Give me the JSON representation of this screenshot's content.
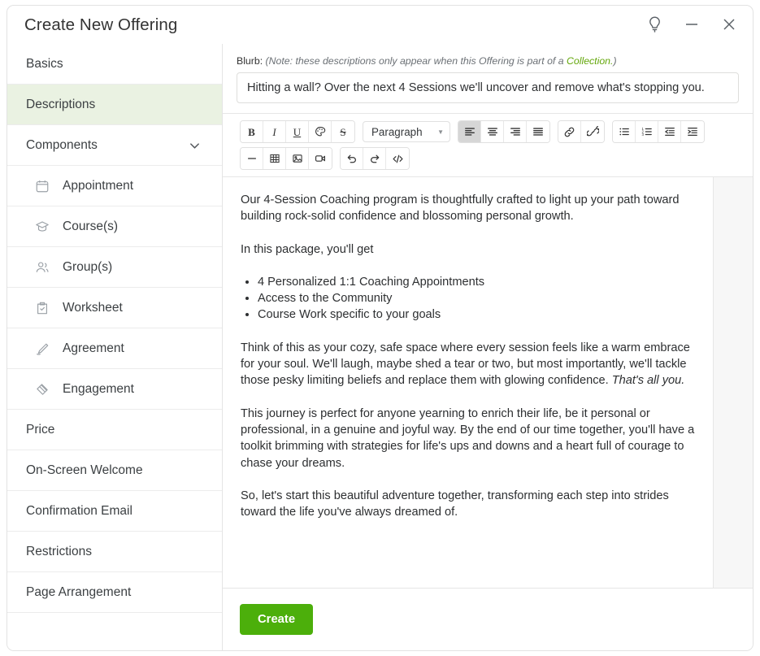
{
  "window": {
    "title": "Create New Offering",
    "controls": [
      {
        "name": "help-tips",
        "icon": "lightbulb-icon"
      },
      {
        "name": "minimize",
        "icon": "minimize-icon"
      },
      {
        "name": "close",
        "icon": "close-icon"
      }
    ]
  },
  "sidebar": {
    "items": [
      {
        "label": "Basics",
        "active": false
      },
      {
        "label": "Descriptions",
        "active": true
      },
      {
        "label": "Components",
        "active": false,
        "expandable": true,
        "expanded": true
      }
    ],
    "components": [
      {
        "label": "Appointment",
        "icon": "calendar-icon"
      },
      {
        "label": "Course(s)",
        "icon": "graduation-cap-icon"
      },
      {
        "label": "Group(s)",
        "icon": "people-icon"
      },
      {
        "label": "Worksheet",
        "icon": "clipboard-check-icon"
      },
      {
        "label": "Agreement",
        "icon": "pen-signature-icon"
      },
      {
        "label": "Engagement",
        "icon": "handshake-icon"
      }
    ],
    "items_after": [
      {
        "label": "Price"
      },
      {
        "label": "On-Screen Welcome"
      },
      {
        "label": "Confirmation Email"
      },
      {
        "label": "Restrictions"
      },
      {
        "label": "Page Arrangement"
      }
    ]
  },
  "blurb": {
    "label": "Blurb:",
    "note_prefix": "(Note: these descriptions only appear when this Offering is part of a ",
    "note_link": "Collection.",
    "note_suffix": ")",
    "value": "Hitting a wall? Over the next 4 Sessions we'll uncover and remove what's stopping you.",
    "placeholder": ""
  },
  "toolbar": {
    "row1_group1": [
      {
        "name": "bold-icon",
        "label": "B"
      },
      {
        "name": "italic-icon",
        "label": "I"
      },
      {
        "name": "underline-icon",
        "label": "U"
      },
      {
        "name": "text-color-icon",
        "label": ""
      },
      {
        "name": "strikethrough-icon",
        "label": "S"
      }
    ],
    "paragraph_select": "Paragraph",
    "row1_align": [
      {
        "name": "align-left-icon",
        "active": true
      },
      {
        "name": "align-center-icon",
        "active": false
      },
      {
        "name": "align-right-icon",
        "active": false
      },
      {
        "name": "align-justify-icon",
        "active": false
      }
    ],
    "row1_link": [
      {
        "name": "link-icon"
      },
      {
        "name": "unlink-icon"
      }
    ],
    "row1_list": [
      {
        "name": "bullet-list-icon"
      },
      {
        "name": "numbered-list-icon"
      },
      {
        "name": "outdent-icon"
      },
      {
        "name": "indent-icon"
      }
    ],
    "row2_insert": [
      {
        "name": "horizontal-rule-icon"
      },
      {
        "name": "table-icon"
      },
      {
        "name": "image-icon"
      },
      {
        "name": "video-icon"
      }
    ],
    "row2_history": [
      {
        "name": "undo-icon"
      },
      {
        "name": "redo-icon"
      },
      {
        "name": "code-view-icon"
      }
    ]
  },
  "editor": {
    "paragraph_1": "Our 4-Session Coaching program is thoughtfully crafted to light up your path toward building rock-solid confidence and blossoming personal growth.",
    "paragraph_2": "In this package, you'll get",
    "bullets": [
      "4 Personalized 1:1 Coaching Appointments",
      "Access to the Community",
      "Course Work specific to your goals"
    ],
    "paragraph_3_text": "Think of this as your cozy, safe space where every session feels like a warm embrace for your soul. We'll laugh, maybe shed a tear or two, but most importantly, we'll tackle those pesky limiting beliefs and replace them with glowing confidence. ",
    "paragraph_3_italic": "That's all you.",
    "paragraph_4": "This journey is perfect for anyone yearning to enrich their life, be it personal or professional, in a genuine and joyful way. By the end of our time together, you'll have a toolkit brimming with strategies for life's ups and downs and a heart full of courage to chase your dreams.",
    "paragraph_5": "So, let's start this beautiful adventure together, transforming each step into strides toward the life you've always dreamed of."
  },
  "footer": {
    "create_label": "Create"
  },
  "colors": {
    "accent_green": "#4caf0b",
    "link_green": "#64a70b",
    "active_nav_bg": "#eaf2e2"
  }
}
